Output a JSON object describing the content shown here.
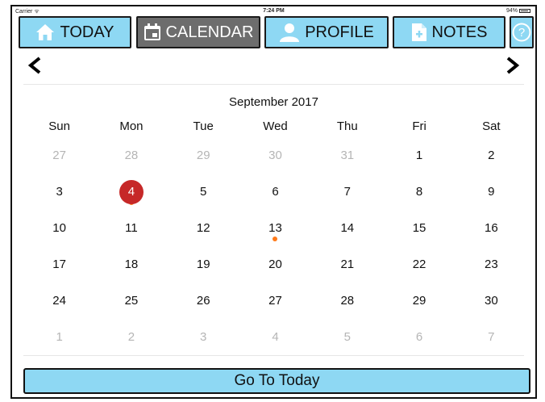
{
  "statusbar": {
    "carrier": "Carrier ᯤ",
    "time": "7:24 PM",
    "battery": "94%"
  },
  "nav": {
    "today": "TODAY",
    "calendar": "CALENDAR",
    "profile": "PROFILE",
    "notes": "NOTES",
    "help": "?"
  },
  "calendar": {
    "prev": "<",
    "next": ">",
    "month_title": "September 2017",
    "weekdays": [
      "Sun",
      "Mon",
      "Tue",
      "Wed",
      "Thu",
      "Fri",
      "Sat"
    ],
    "weeks": [
      [
        {
          "d": "27",
          "muted": true
        },
        {
          "d": "28",
          "muted": true
        },
        {
          "d": "29",
          "muted": true
        },
        {
          "d": "30",
          "muted": true
        },
        {
          "d": "31",
          "muted": true
        },
        {
          "d": "1"
        },
        {
          "d": "2"
        }
      ],
      [
        {
          "d": "3"
        },
        {
          "d": "4",
          "selected": true,
          "dot": true
        },
        {
          "d": "5"
        },
        {
          "d": "6"
        },
        {
          "d": "7"
        },
        {
          "d": "8"
        },
        {
          "d": "9"
        }
      ],
      [
        {
          "d": "10"
        },
        {
          "d": "11"
        },
        {
          "d": "12"
        },
        {
          "d": "13",
          "dot": true
        },
        {
          "d": "14"
        },
        {
          "d": "15"
        },
        {
          "d": "16"
        }
      ],
      [
        {
          "d": "17"
        },
        {
          "d": "18"
        },
        {
          "d": "19"
        },
        {
          "d": "20"
        },
        {
          "d": "21"
        },
        {
          "d": "22"
        },
        {
          "d": "23"
        }
      ],
      [
        {
          "d": "24"
        },
        {
          "d": "25"
        },
        {
          "d": "26"
        },
        {
          "d": "27"
        },
        {
          "d": "28"
        },
        {
          "d": "29"
        },
        {
          "d": "30"
        }
      ],
      [
        {
          "d": "1",
          "muted": true
        },
        {
          "d": "2",
          "muted": true
        },
        {
          "d": "3",
          "muted": true
        },
        {
          "d": "4",
          "muted": true
        },
        {
          "d": "5",
          "muted": true
        },
        {
          "d": "6",
          "muted": true
        },
        {
          "d": "7",
          "muted": true
        }
      ]
    ]
  },
  "go_to_today": "Go To Today",
  "colors": {
    "tab": "#8ed8f3",
    "tab_active": "#6d6d6d",
    "selected": "#c62828",
    "event_dot": "#ff7a1a"
  },
  "icons": {
    "today": "home-icon",
    "calendar": "calendar-icon",
    "profile": "person-icon",
    "notes": "document-plus-icon",
    "help": "question-icon"
  }
}
